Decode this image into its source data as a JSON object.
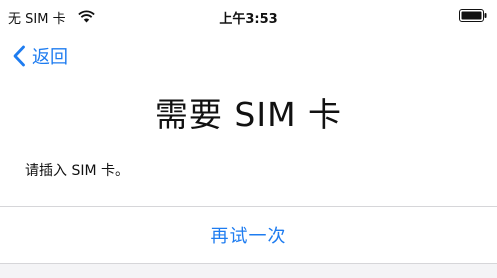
{
  "status_bar": {
    "carrier": "无 SIM 卡",
    "time": "上午3:53",
    "wifi_icon": "wifi-icon",
    "battery_icon": "battery-icon"
  },
  "nav": {
    "back_label": "返回",
    "back_icon": "chevron-left-icon"
  },
  "main": {
    "title": "需要 SIM 卡",
    "message": "请插入 SIM 卡。",
    "retry_label": "再试一次"
  },
  "colors": {
    "accent": "#1e7cf0",
    "text": "#111111",
    "divider": "#d6d6d9"
  }
}
